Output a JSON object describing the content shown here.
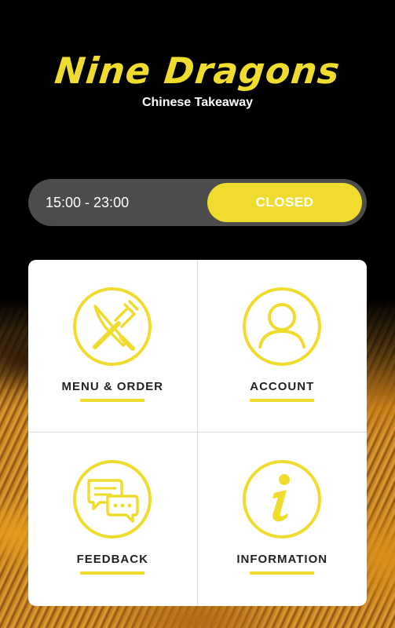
{
  "brand": {
    "name": "Nine Dragons",
    "subtitle": "Chinese Takeaway"
  },
  "hours": {
    "range": "15:00 - 23:00",
    "status": "CLOSED"
  },
  "menu": [
    {
      "label": "MENU & ORDER",
      "icon": "fork-knife-icon"
    },
    {
      "label": "ACCOUNT",
      "icon": "user-icon"
    },
    {
      "label": "FEEDBACK",
      "icon": "chat-bubbles-icon"
    },
    {
      "label": "INFORMATION",
      "icon": "info-icon"
    }
  ],
  "colors": {
    "accent": "#f0dc2e",
    "bar": "#4c4c4c",
    "background": "#000000"
  }
}
